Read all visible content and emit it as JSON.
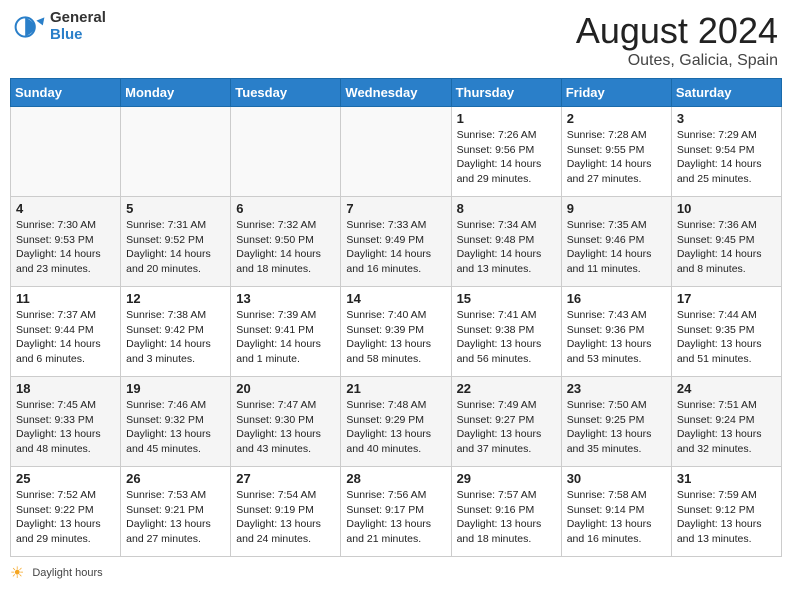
{
  "header": {
    "logo_general": "General",
    "logo_blue": "Blue",
    "title": "August 2024",
    "subtitle": "Outes, Galicia, Spain"
  },
  "days_of_week": [
    "Sunday",
    "Monday",
    "Tuesday",
    "Wednesday",
    "Thursday",
    "Friday",
    "Saturday"
  ],
  "weeks": [
    [
      {
        "day": "",
        "info": "",
        "empty": true
      },
      {
        "day": "",
        "info": "",
        "empty": true
      },
      {
        "day": "",
        "info": "",
        "empty": true
      },
      {
        "day": "",
        "info": "",
        "empty": true
      },
      {
        "day": "1",
        "info": "Sunrise: 7:26 AM\nSunset: 9:56 PM\nDaylight: 14 hours\nand 29 minutes.",
        "empty": false
      },
      {
        "day": "2",
        "info": "Sunrise: 7:28 AM\nSunset: 9:55 PM\nDaylight: 14 hours\nand 27 minutes.",
        "empty": false
      },
      {
        "day": "3",
        "info": "Sunrise: 7:29 AM\nSunset: 9:54 PM\nDaylight: 14 hours\nand 25 minutes.",
        "empty": false
      }
    ],
    [
      {
        "day": "4",
        "info": "Sunrise: 7:30 AM\nSunset: 9:53 PM\nDaylight: 14 hours\nand 23 minutes.",
        "empty": false
      },
      {
        "day": "5",
        "info": "Sunrise: 7:31 AM\nSunset: 9:52 PM\nDaylight: 14 hours\nand 20 minutes.",
        "empty": false
      },
      {
        "day": "6",
        "info": "Sunrise: 7:32 AM\nSunset: 9:50 PM\nDaylight: 14 hours\nand 18 minutes.",
        "empty": false
      },
      {
        "day": "7",
        "info": "Sunrise: 7:33 AM\nSunset: 9:49 PM\nDaylight: 14 hours\nand 16 minutes.",
        "empty": false
      },
      {
        "day": "8",
        "info": "Sunrise: 7:34 AM\nSunset: 9:48 PM\nDaylight: 14 hours\nand 13 minutes.",
        "empty": false
      },
      {
        "day": "9",
        "info": "Sunrise: 7:35 AM\nSunset: 9:46 PM\nDaylight: 14 hours\nand 11 minutes.",
        "empty": false
      },
      {
        "day": "10",
        "info": "Sunrise: 7:36 AM\nSunset: 9:45 PM\nDaylight: 14 hours\nand 8 minutes.",
        "empty": false
      }
    ],
    [
      {
        "day": "11",
        "info": "Sunrise: 7:37 AM\nSunset: 9:44 PM\nDaylight: 14 hours\nand 6 minutes.",
        "empty": false
      },
      {
        "day": "12",
        "info": "Sunrise: 7:38 AM\nSunset: 9:42 PM\nDaylight: 14 hours\nand 3 minutes.",
        "empty": false
      },
      {
        "day": "13",
        "info": "Sunrise: 7:39 AM\nSunset: 9:41 PM\nDaylight: 14 hours\nand 1 minute.",
        "empty": false
      },
      {
        "day": "14",
        "info": "Sunrise: 7:40 AM\nSunset: 9:39 PM\nDaylight: 13 hours\nand 58 minutes.",
        "empty": false
      },
      {
        "day": "15",
        "info": "Sunrise: 7:41 AM\nSunset: 9:38 PM\nDaylight: 13 hours\nand 56 minutes.",
        "empty": false
      },
      {
        "day": "16",
        "info": "Sunrise: 7:43 AM\nSunset: 9:36 PM\nDaylight: 13 hours\nand 53 minutes.",
        "empty": false
      },
      {
        "day": "17",
        "info": "Sunrise: 7:44 AM\nSunset: 9:35 PM\nDaylight: 13 hours\nand 51 minutes.",
        "empty": false
      }
    ],
    [
      {
        "day": "18",
        "info": "Sunrise: 7:45 AM\nSunset: 9:33 PM\nDaylight: 13 hours\nand 48 minutes.",
        "empty": false
      },
      {
        "day": "19",
        "info": "Sunrise: 7:46 AM\nSunset: 9:32 PM\nDaylight: 13 hours\nand 45 minutes.",
        "empty": false
      },
      {
        "day": "20",
        "info": "Sunrise: 7:47 AM\nSunset: 9:30 PM\nDaylight: 13 hours\nand 43 minutes.",
        "empty": false
      },
      {
        "day": "21",
        "info": "Sunrise: 7:48 AM\nSunset: 9:29 PM\nDaylight: 13 hours\nand 40 minutes.",
        "empty": false
      },
      {
        "day": "22",
        "info": "Sunrise: 7:49 AM\nSunset: 9:27 PM\nDaylight: 13 hours\nand 37 minutes.",
        "empty": false
      },
      {
        "day": "23",
        "info": "Sunrise: 7:50 AM\nSunset: 9:25 PM\nDaylight: 13 hours\nand 35 minutes.",
        "empty": false
      },
      {
        "day": "24",
        "info": "Sunrise: 7:51 AM\nSunset: 9:24 PM\nDaylight: 13 hours\nand 32 minutes.",
        "empty": false
      }
    ],
    [
      {
        "day": "25",
        "info": "Sunrise: 7:52 AM\nSunset: 9:22 PM\nDaylight: 13 hours\nand 29 minutes.",
        "empty": false
      },
      {
        "day": "26",
        "info": "Sunrise: 7:53 AM\nSunset: 9:21 PM\nDaylight: 13 hours\nand 27 minutes.",
        "empty": false
      },
      {
        "day": "27",
        "info": "Sunrise: 7:54 AM\nSunset: 9:19 PM\nDaylight: 13 hours\nand 24 minutes.",
        "empty": false
      },
      {
        "day": "28",
        "info": "Sunrise: 7:56 AM\nSunset: 9:17 PM\nDaylight: 13 hours\nand 21 minutes.",
        "empty": false
      },
      {
        "day": "29",
        "info": "Sunrise: 7:57 AM\nSunset: 9:16 PM\nDaylight: 13 hours\nand 18 minutes.",
        "empty": false
      },
      {
        "day": "30",
        "info": "Sunrise: 7:58 AM\nSunset: 9:14 PM\nDaylight: 13 hours\nand 16 minutes.",
        "empty": false
      },
      {
        "day": "31",
        "info": "Sunrise: 7:59 AM\nSunset: 9:12 PM\nDaylight: 13 hours\nand 13 minutes.",
        "empty": false
      }
    ]
  ],
  "footer": {
    "daylight_label": "Daylight hours"
  }
}
